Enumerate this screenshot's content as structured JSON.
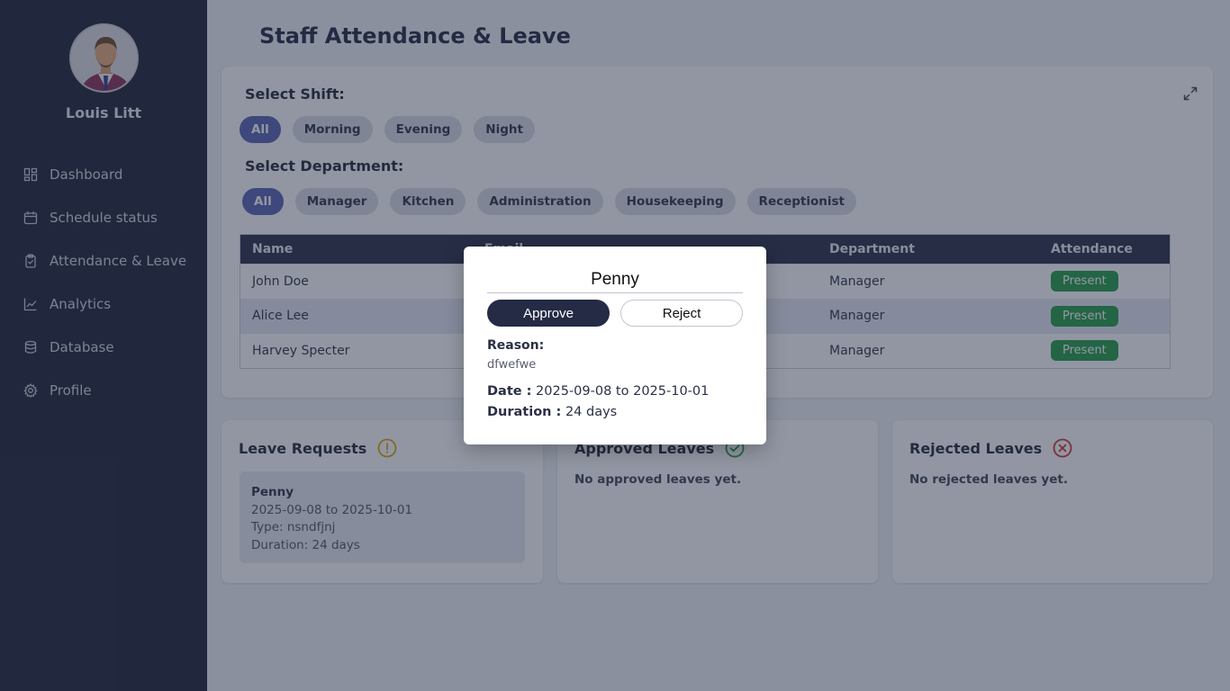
{
  "sidebar": {
    "user_name": "Louis Litt",
    "nav": [
      {
        "label": "Dashboard",
        "icon": "dashboard-icon"
      },
      {
        "label": "Schedule status",
        "icon": "calendar-icon"
      },
      {
        "label": "Attendance & Leave",
        "icon": "clipboard-icon"
      },
      {
        "label": "Analytics",
        "icon": "chart-line-icon"
      },
      {
        "label": "Database",
        "icon": "database-icon"
      },
      {
        "label": "Profile",
        "icon": "gear-icon"
      }
    ]
  },
  "page": {
    "title": "Staff Attendance & Leave"
  },
  "filters": {
    "shift_label": "Select Shift:",
    "shifts": [
      "All",
      "Morning",
      "Evening",
      "Night"
    ],
    "department_label": "Select Department:",
    "departments": [
      "All",
      "Manager",
      "Kitchen",
      "Administration",
      "Housekeeping",
      "Receptionist"
    ]
  },
  "table": {
    "headers": {
      "name": "Name",
      "email": "Email",
      "department": "Department",
      "attendance": "Attendance"
    },
    "rows": [
      {
        "name": "John Doe",
        "department": "Manager",
        "attendance": "Present"
      },
      {
        "name": "Alice Lee",
        "department": "Manager",
        "attendance": "Present"
      },
      {
        "name": "Harvey Specter",
        "department": "Manager",
        "attendance": "Present"
      }
    ]
  },
  "leave_requests": {
    "title": "Leave Requests",
    "item": {
      "name": "Penny",
      "dates": "2025-09-08 to 2025-10-01",
      "type": "Type: nsndfjnj",
      "duration": "Duration: 24 days"
    }
  },
  "approved_leaves": {
    "title": "Approved Leaves",
    "empty": "No approved leaves yet."
  },
  "rejected_leaves": {
    "title": "Rejected Leaves",
    "empty": "No rejected leaves yet."
  },
  "modal": {
    "name": "Penny",
    "approve_label": "Approve",
    "reject_label": "Reject",
    "reason_label": "Reason:",
    "reason_value": "dfwefwe",
    "date_label": "Date :",
    "date_value": "2025-09-08 to 2025-10-01",
    "duration_label": "Duration :",
    "duration_value": "24 days"
  },
  "colors": {
    "sidebar_bg": "#1b1f33",
    "accent": "#5561b2",
    "present_green": "#1f9a45",
    "pending_amber": "#d9a300",
    "approved_green": "#1f9a45",
    "rejected_red": "#d12f2f"
  }
}
